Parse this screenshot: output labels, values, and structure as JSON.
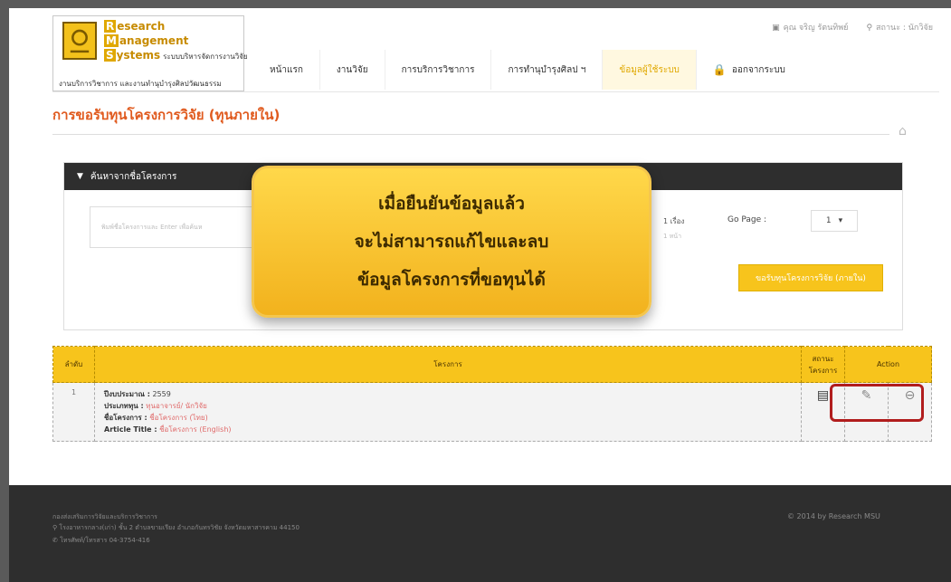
{
  "logo": {
    "line1_cap": "R",
    "line1": "esearch",
    "line2_cap": "M",
    "line2": "anagement",
    "line3_cap": "S",
    "line3": "ystems",
    "line3_small": "ระบบบริหารจัดการงานวิจัย",
    "subtitle": "งานบริการวิชาการ และงานทำนุบำรุงศิลปวัฒนธรรม"
  },
  "user": {
    "name": "คุณ จริญ รัตนทิพย์",
    "status": "สถานะ : นักวิจัย"
  },
  "nav": [
    "หน้าแรก",
    "งานวิจัย",
    "การบริการวิชาการ",
    "การทำนุบำรุงศิลป ฯ",
    "ข้อมูลผู้ใช้ระบบ",
    "ออกจากระบบ"
  ],
  "page_title": "การขอรับทุนโครงการวิจัย (ทุนภายใน)",
  "search": {
    "header": "ค้นหาจากชื่อโครงการ",
    "placeholder": "พิมพ์ชื่อโครงการและ Enter เพื่อค้นห",
    "count_text": "1 เรื่อง",
    "count_sub": "1 หน้า",
    "goto_label": "Go Page :",
    "goto_value": "1",
    "apply_button": "ขอรับทุนโครงการวิจัย (ภายใน)"
  },
  "callout": {
    "line1": "เมื่อยืนยันข้อมูลแล้ว",
    "line2": "จะไม่สามารถแก้ไขและลบ",
    "line3": "ข้อมูลโครงการที่ขอทุนได้"
  },
  "table": {
    "headers": {
      "no": "ลำดับ",
      "project": "โครงการ",
      "status": "สถานะ โครงการ",
      "action": "Action"
    },
    "row": {
      "no": "1",
      "budget_label": "ปีงบประมาณ :",
      "budget": "2559",
      "type_label": "ประเภททุน :",
      "type": "ทุนอาจารย์/ นักวิจัย",
      "name_label": "ชื่อโครงการ :",
      "name": "ชื่อโครงการ (ไทย)",
      "title_label": "Article Title :",
      "title": "ชื่อโครงการ (English)"
    }
  },
  "footer": {
    "line1": "กองส่งเสริมการวิจัยและบริการวิชาการ",
    "line2": "โรงอาหารกลาง(เก่า) ชั้น 2 ตำบลขามเรียง อำเภอกันทรวิชัย จังหวัดมหาสารคาม 44150",
    "line3": "โทรศัพท์/โทรสาร 04-3754-416",
    "copyright": "© 2014 by Research MSU"
  }
}
